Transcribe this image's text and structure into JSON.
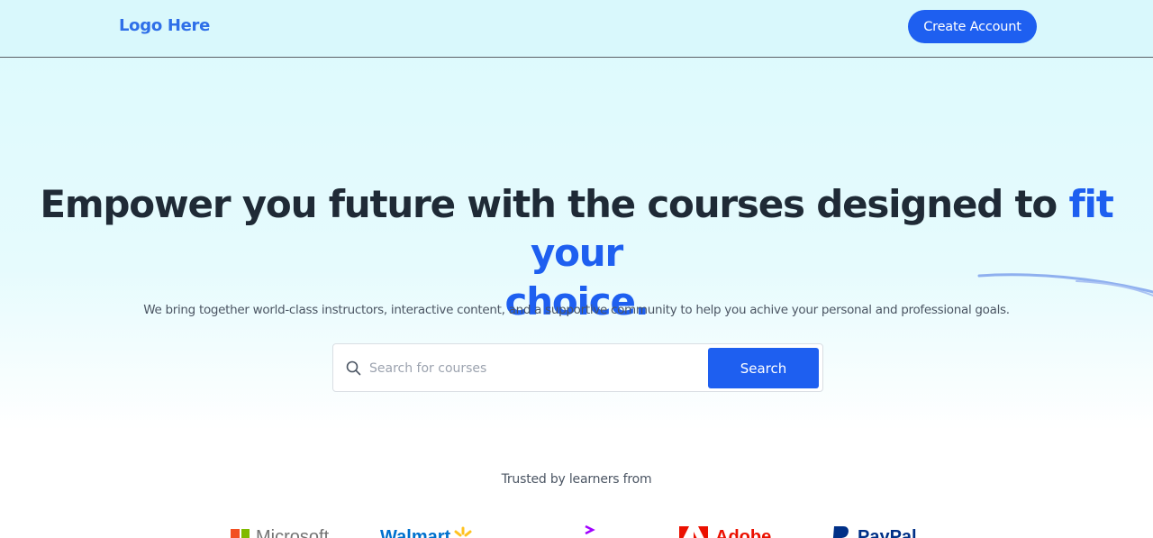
{
  "nav": {
    "logo": "Logo Here",
    "cta": "Create Account"
  },
  "hero": {
    "headline_part1": "Empower you future with the courses designed to ",
    "headline_highlight1": "fit your",
    "headline_highlight2": "choice.",
    "subtitle": "We bring together world-class instructors, interactive content, and a supportive community to help you achive your personal and professional goals."
  },
  "search": {
    "placeholder": "Search for courses",
    "button": "Search",
    "icon": "search-icon"
  },
  "trusted": {
    "label": "Trusted by learners from",
    "brands": [
      "Microsoft",
      "Walmart",
      "Accenture",
      "Adobe",
      "PayPal"
    ]
  },
  "colors": {
    "accent": "#1e5ff0",
    "headline": "#1f2a36",
    "nav_bg": "#d9f8fc"
  }
}
